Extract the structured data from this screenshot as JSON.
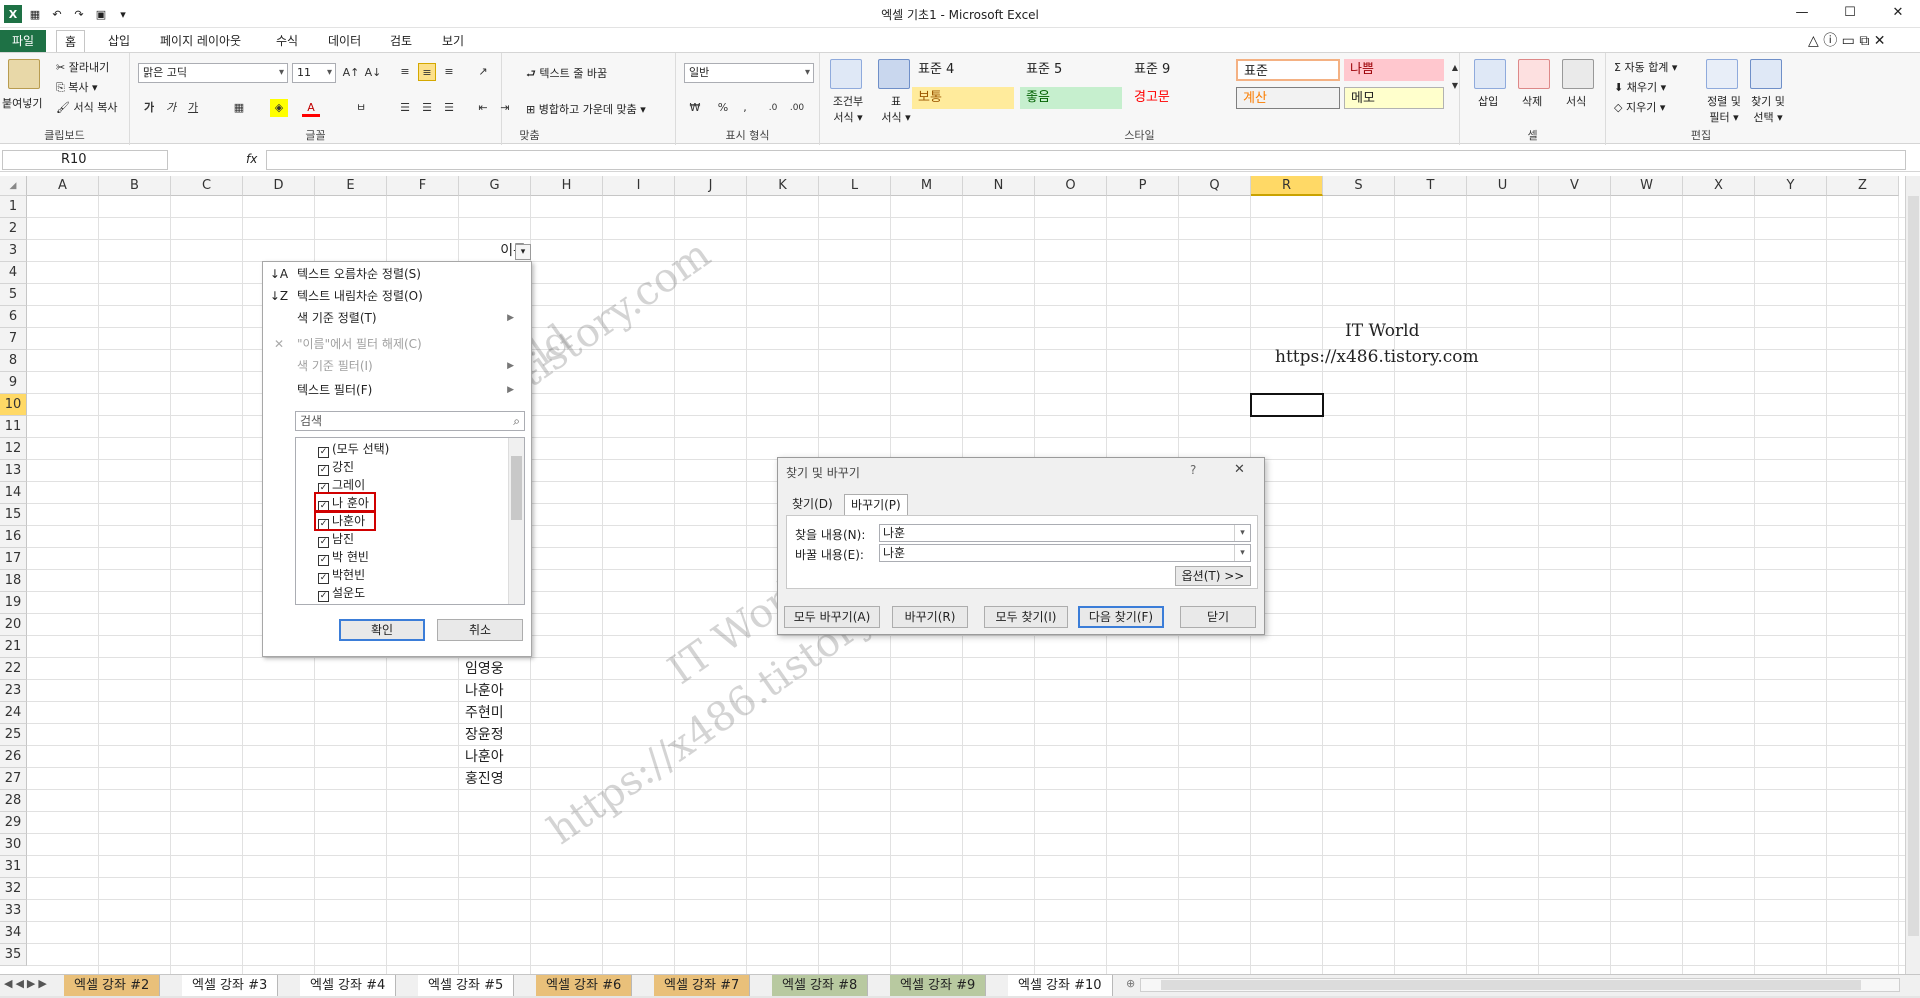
{
  "window": {
    "title": "엑셀 기초1 - Microsoft Excel"
  },
  "ribbon_tabs": [
    "파일",
    "홈",
    "삽입",
    "페이지 레이아웃",
    "수식",
    "데이터",
    "검토",
    "보기"
  ],
  "clipboard": {
    "paste": "붙여넣기",
    "cut": "잘라내기",
    "copy": "복사 ▾",
    "format_painter": "서식 복사",
    "label": "클립보드"
  },
  "font": {
    "name": "맑은 고딕",
    "size": "11",
    "label": "글꼴",
    "bold": "가",
    "italic": "가",
    "underline": "가"
  },
  "alignment": {
    "wrap": "텍스트 줄 바꿈",
    "merge": "병합하고 가운데 맞춤 ▾",
    "label": "맞춤"
  },
  "number": {
    "format": "일반",
    "label": "표시 형식"
  },
  "styles": {
    "cond_format": "조건부\n서식 ▾",
    "table_format": "표\n서식 ▾",
    "label": "스타일",
    "cells": [
      {
        "text": "표준 4",
        "bg": "#ffffff",
        "color": "#222222"
      },
      {
        "text": "표준 5",
        "bg": "#ffffff",
        "color": "#222222"
      },
      {
        "text": "표준 9",
        "bg": "#ffffff",
        "color": "#222222"
      },
      {
        "text": "표준",
        "bg": "#ffffff",
        "color": "#222222"
      },
      {
        "text": "나쁨",
        "bg": "#ffc7ce",
        "color": "#9c0006"
      },
      {
        "text": "보통",
        "bg": "#ffeb9c",
        "color": "#9c5700"
      },
      {
        "text": "좋음",
        "bg": "#c6efce",
        "color": "#006100"
      },
      {
        "text": "경고문",
        "bg": "#ffffff",
        "color": "#ff0000"
      },
      {
        "text": "계산",
        "bg": "#f2f2f2",
        "color": "#fa7d00"
      },
      {
        "text": "메모",
        "bg": "#ffffcc",
        "color": "#222222"
      }
    ]
  },
  "cells_group": {
    "insert": "삽입",
    "delete": "삭제",
    "format": "서식",
    "label": "셀"
  },
  "editing": {
    "autosum": "자동 합계 ▾",
    "fill": "채우기 ▾",
    "clear": "지우기 ▾",
    "sort": "정렬 및\n필터 ▾",
    "find": "찾기 및\n선택 ▾",
    "label": "편집"
  },
  "formula_bar": {
    "name_box": "R10",
    "fx": "fx"
  },
  "columns": [
    "A",
    "B",
    "C",
    "D",
    "E",
    "F",
    "G",
    "H",
    "I",
    "J",
    "K",
    "L",
    "M",
    "N",
    "O",
    "P",
    "Q",
    "R",
    "S",
    "T",
    "U",
    "V",
    "W",
    "X",
    "Y",
    "Z"
  ],
  "selected_column": "R",
  "selected_row": "10",
  "rows": [
    "1",
    "2",
    "3",
    "4",
    "5",
    "6",
    "7",
    "8",
    "9",
    "10",
    "11",
    "12",
    "13",
    "14",
    "15",
    "16",
    "17",
    "18",
    "19",
    "20",
    "21",
    "22",
    "23",
    "24",
    "25",
    "26",
    "27",
    "28",
    "29",
    "30",
    "31",
    "32",
    "33",
    "34",
    "35"
  ],
  "sheet_cells": {
    "header": "이름",
    "names": [
      "임영웅",
      "나훈아",
      "주현미",
      "장윤정",
      "나훈아",
      "홍진영"
    ],
    "note_title": "IT World",
    "note_url": "https://x486.tistory.com"
  },
  "watermark": {
    "line1": "IT World",
    "line2": "https://x486.tistory.com"
  },
  "filter_menu": {
    "sort_asc": "텍스트 오름차순 정렬(S)",
    "sort_desc": "텍스트 내림차순 정렬(O)",
    "sort_color": "색 기준 정렬(T)",
    "clear_filter": "\"이름\"에서 필터 해제(C)",
    "filter_color": "색 기준 필터(I)",
    "text_filter": "텍스트 필터(F)",
    "search_placeholder": "검색",
    "items": [
      "(모두 선택)",
      "강진",
      "그레이",
      "나 훈아",
      "나훈아",
      "남진",
      "박 현빈",
      "박현빈",
      "설운도"
    ],
    "ok": "확인",
    "cancel": "취소"
  },
  "find_dialog": {
    "title": "찾기 및 바꾸기",
    "help": "?",
    "close": "✕",
    "tab_find": "찾기(D)",
    "tab_replace": "바꾸기(P)",
    "find_label": "찾을 내용(N):",
    "find_value": "나훈",
    "replace_label": "바꿀 내용(E):",
    "replace_value": "나훈",
    "options": "옵션(T) >>",
    "replace_all": "모두 바꾸기(A)",
    "replace": "바꾸기(R)",
    "find_all": "모두 찾기(I)",
    "find_next": "다음 찾기(F)",
    "close_btn": "닫기"
  },
  "sheet_tabs": [
    {
      "label": "엑셀 강좌 #2",
      "bg": "#e9c07a"
    },
    {
      "label": "엑셀 강좌 #3",
      "bg": "#ffffff"
    },
    {
      "label": "엑셀 강좌 #4",
      "bg": "#ffffff"
    },
    {
      "label": "엑셀 강좌 #5",
      "bg": "#ffffff"
    },
    {
      "label": "엑셀 강좌 #6",
      "bg": "#e9c07a"
    },
    {
      "label": "엑셀 강좌 #7",
      "bg": "#e9c07a"
    },
    {
      "label": "엑셀 강좌 #8",
      "bg": "#b8c9a0"
    },
    {
      "label": "엑셀 강좌 #9",
      "bg": "#b8c9a0"
    },
    {
      "label": "엑셀 강좌 #10",
      "bg": "#ffffff"
    }
  ]
}
